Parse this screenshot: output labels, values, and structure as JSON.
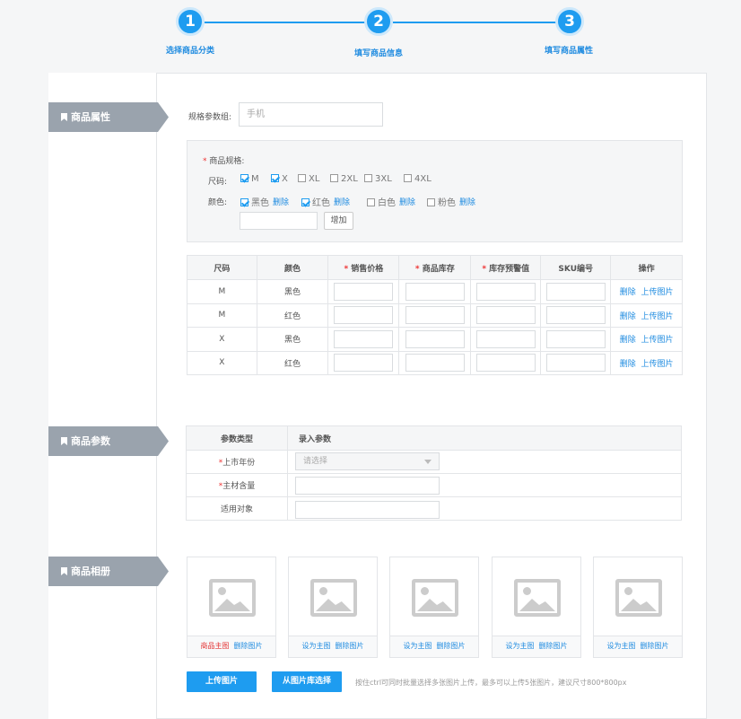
{
  "steps": [
    {
      "num": "1",
      "label": "选择商品分类"
    },
    {
      "num": "2",
      "label": "填写商品信息"
    },
    {
      "num": "3",
      "label": "填写商品属性"
    }
  ],
  "sections": {
    "attributes": "商品属性",
    "params": "商品参数",
    "album": "商品相册"
  },
  "spec_group": {
    "label": "规格参数组:",
    "value": "手机"
  },
  "spec_box": {
    "title_star": "*",
    "title": "商品规格:",
    "size_label": "尺码:",
    "sizes": [
      {
        "label": "M",
        "checked": true
      },
      {
        "label": "X",
        "checked": true
      },
      {
        "label": "XL",
        "checked": false
      },
      {
        "label": "2XL",
        "checked": false
      },
      {
        "label": "3XL",
        "checked": false
      },
      {
        "label": "4XL",
        "checked": false
      }
    ],
    "color_label": "颜色:",
    "colors": [
      {
        "label": "黑色",
        "checked": true
      },
      {
        "label": "红色",
        "checked": true
      },
      {
        "label": "白色",
        "checked": false
      },
      {
        "label": "粉色",
        "checked": false
      }
    ],
    "delete_label": "删除",
    "add_button": "增加"
  },
  "sku_table": {
    "headers": [
      "尺码",
      "颜色",
      "销售价格",
      "商品库存",
      "库存预警值",
      "SKU编号",
      "操作"
    ],
    "required_star": "*",
    "rows": [
      {
        "size": "M",
        "color": "黑色"
      },
      {
        "size": "M",
        "color": "红色"
      },
      {
        "size": "X",
        "color": "黑色"
      },
      {
        "size": "X",
        "color": "红色"
      }
    ],
    "op_delete": "删除",
    "op_upload": "上传图片"
  },
  "param_table": {
    "headers": [
      "参数类型",
      "录入参数"
    ],
    "rows": [
      {
        "star": "*",
        "label": "上市年份",
        "placeholder": "请选择"
      },
      {
        "star": "*",
        "label": "主材含量",
        "placeholder": ""
      },
      {
        "star": "",
        "label": "适用对象",
        "placeholder": ""
      }
    ]
  },
  "album": {
    "cards": [
      {
        "primary": "商品主图",
        "is_main": true,
        "delete": "删除图片"
      },
      {
        "primary": "设为主图",
        "is_main": false,
        "delete": "删除图片"
      },
      {
        "primary": "设为主图",
        "is_main": false,
        "delete": "删除图片"
      },
      {
        "primary": "设为主图",
        "is_main": false,
        "delete": "删除图片"
      },
      {
        "primary": "设为主图",
        "is_main": false,
        "delete": "删除图片"
      }
    ],
    "upload_button": "上传图片",
    "library_button": "从图片库选择",
    "hint": "按住ctrl可同时批量选择多张图片上传，最多可以上传5张图片，建议尺寸800*800px"
  },
  "colors": {
    "accent": "#1e9cf0",
    "tag_bg": "#9aa3ad",
    "required": "#e33333"
  }
}
